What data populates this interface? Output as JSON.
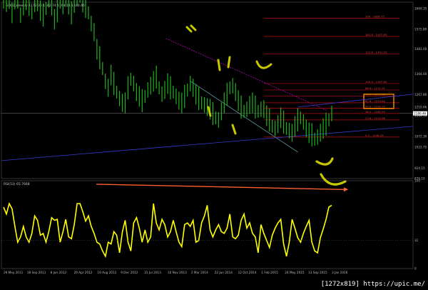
{
  "chart_data": [
    {
      "type": "ohlc",
      "title": "GOLD,Weekly 1172.30 1182.74 1164.14 1180.46",
      "ylim": [
        876.1,
        1700
      ],
      "yticks": [
        "1669.35",
        "1572.80",
        "1481.00",
        "1364.60",
        "1267.80",
        "1210.46",
        "1169.10",
        "1072.30",
        "1022.75",
        "924.15",
        "876.10"
      ],
      "xticks": [
        "29 May 2011",
        "18 Sep 2011",
        "8 Jan 2012",
        "29 Apr 2012",
        "19 Aug 2012",
        "9 Dec 2012",
        "31 Jul 2013",
        "10 Nov 2013",
        "2 Mar 2014",
        "22 Jun 2014",
        "12 Oct 2014",
        "1 Feb 2015",
        "24 May 2015",
        "13 Sep 2015",
        "3 Jan 2016"
      ],
      "current_price": 1180.46,
      "fib_levels": [
        {
          "label": "100 - 1856.75",
          "value": 1625
        },
        {
          "label": "161.8 - 1457.83",
          "value": 1540
        },
        {
          "label": "123.6 - 1401.03",
          "value": 1458
        },
        {
          "label": "100.0 - 1307.82",
          "value": 1320
        },
        {
          "label": "88.6 - 1271.51",
          "value": 1290
        },
        {
          "label": "76.4 - 1251.86",
          "value": 1262
        },
        {
          "label": "61.8 - 1220.84",
          "value": 1230
        },
        {
          "label": "50.0 - 1190.35",
          "value": 1205
        },
        {
          "label": "38.2 - 1160.93",
          "value": 1180
        },
        {
          "label": "23.6 - 1124.98",
          "value": 1150
        },
        {
          "label": "0.0 - 1046.29",
          "value": 1070
        }
      ],
      "price_series": [
        1700,
        1690,
        1710,
        1650,
        1720,
        1700,
        1640,
        1680,
        1710,
        1690,
        1650,
        1690,
        1700,
        1660,
        1640,
        1670,
        1710,
        1680,
        1620,
        1660,
        1700,
        1680,
        1720,
        1690,
        1650,
        1680,
        1720,
        1740,
        1700,
        1680,
        1650,
        1600,
        1560,
        1480,
        1440,
        1390,
        1330,
        1300,
        1360,
        1320,
        1280,
        1250,
        1230,
        1230,
        1300,
        1340,
        1320,
        1280,
        1260,
        1240,
        1260,
        1290,
        1310,
        1330,
        1350,
        1300,
        1270,
        1290,
        1320,
        1300,
        1280,
        1260,
        1240,
        1230,
        1260,
        1290,
        1320,
        1300,
        1270,
        1250,
        1230,
        1220,
        1210,
        1200,
        1180,
        1160,
        1150,
        1190,
        1230,
        1270,
        1300,
        1310,
        1280,
        1240,
        1210,
        1190,
        1200,
        1220,
        1230,
        1210,
        1190,
        1200,
        1200,
        1170,
        1150,
        1120,
        1110,
        1130,
        1160,
        1140,
        1110,
        1100,
        1090,
        1120,
        1150,
        1160,
        1140,
        1110,
        1090,
        1080,
        1060,
        1070,
        1090,
        1110,
        1130,
        1150,
        1180
      ],
      "trendlines": [
        {
          "name": "magenta",
          "color": "#c000c0",
          "points": [
            [
              0.4,
              1530
            ],
            [
              0.79,
              1195
            ]
          ]
        },
        {
          "name": "teal",
          "color": "#5a9aa0",
          "points": [
            [
              0.46,
              1330
            ],
            [
              0.72,
              1000
            ]
          ]
        },
        {
          "name": "blue-lower",
          "color": "#3a3ad0",
          "points": [
            [
              0,
              960
            ],
            [
              1,
              1120
            ]
          ]
        },
        {
          "name": "blue-upper",
          "color": "#3a3ad0",
          "points": [
            [
              0.72,
              1210
            ],
            [
              1,
              1270
            ]
          ]
        }
      ]
    },
    {
      "type": "line",
      "title": "RSI(53) 65.7668",
      "ylim": [
        0,
        100
      ],
      "yticks": [
        "100",
        "32",
        "0"
      ],
      "series": [
        {
          "color": "#ffff00",
          "values": [
            70,
            62,
            74,
            68,
            48,
            30,
            36,
            48,
            36,
            30,
            40,
            60,
            55,
            38,
            40,
            30,
            42,
            58,
            55,
            56,
            30,
            42,
            56,
            36,
            34,
            50,
            74,
            74,
            65,
            54,
            60,
            48,
            40,
            30,
            28,
            20,
            14,
            30,
            28,
            42,
            38,
            18,
            42,
            55,
            30,
            20,
            52,
            58,
            46,
            30,
            44,
            30,
            36,
            74,
            52,
            44,
            56,
            50,
            36,
            42,
            55,
            42,
            30,
            25,
            50,
            52,
            48,
            55,
            30,
            32,
            52,
            60,
            72,
            44,
            36,
            44,
            50,
            42,
            40,
            46,
            62,
            36,
            34,
            38,
            55,
            62,
            46,
            52,
            40,
            36,
            18,
            50,
            40,
            32,
            24,
            38,
            46,
            52,
            56,
            28,
            14,
            30,
            56,
            46,
            35,
            30,
            40,
            48,
            55,
            30,
            20,
            18,
            35,
            45,
            56,
            70,
            72
          ]
        }
      ]
    }
  ],
  "annotations": {
    "orange_box_label": "61.8 - 1220.84",
    "rsi_resistance_color": "#ff6030"
  },
  "watermark": "[1272x819] https://upic.me/"
}
